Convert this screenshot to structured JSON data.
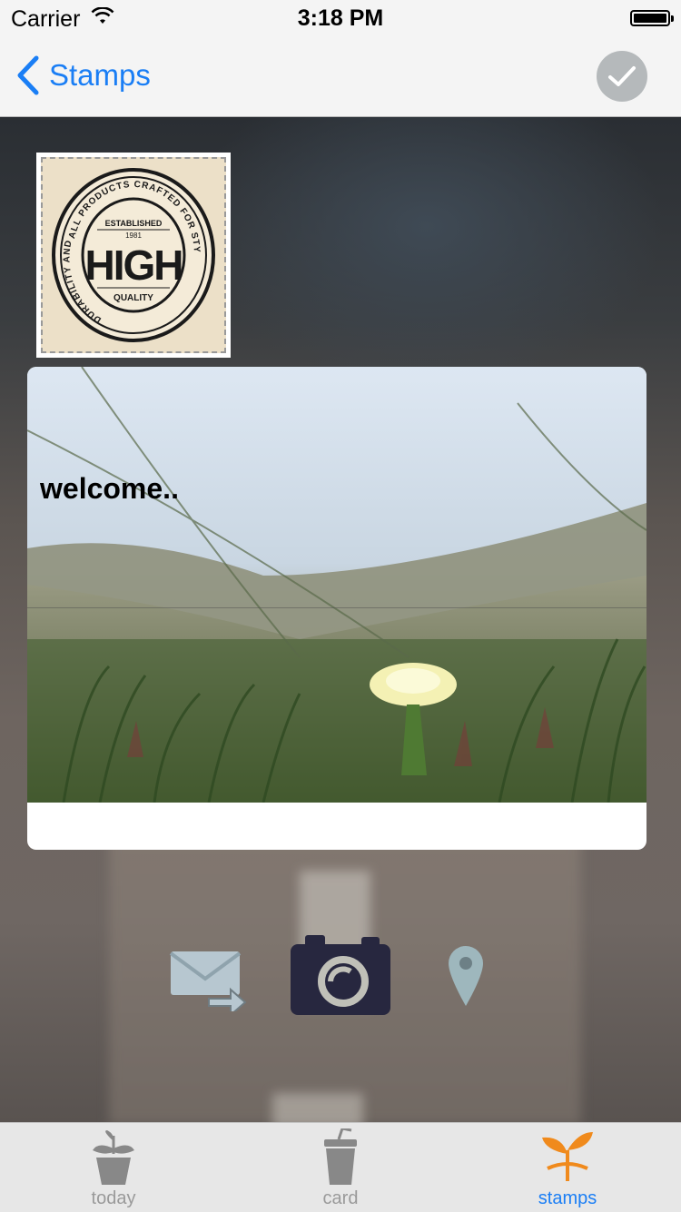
{
  "status_bar": {
    "carrier": "Carrier",
    "time": "3:18 PM"
  },
  "nav": {
    "back_label": "Stamps"
  },
  "stamp": {
    "top_text": "ALL PRODUCTS CRAFTED FOR STYLE AND QUALITY",
    "left_text": "DURABILITY AND STRENGTH",
    "established": "ESTABLISHED",
    "year": "1981",
    "headline": "HIGH",
    "quality": "QUALITY"
  },
  "card": {
    "message": "welcome.."
  },
  "actions": {
    "mail_icon": "mail-forward-icon",
    "camera_icon": "camera-icon",
    "pin_icon": "location-pin-icon"
  },
  "tabs": [
    {
      "label": "today",
      "icon": "plant-pot-icon",
      "active": false
    },
    {
      "label": "card",
      "icon": "cup-icon",
      "active": false
    },
    {
      "label": "stamps",
      "icon": "sprout-icon",
      "active": true
    }
  ],
  "colors": {
    "accent": "#1a7ef5",
    "active_tab_icon": "#f08a1c",
    "inactive_tab": "#9a9a9a"
  }
}
